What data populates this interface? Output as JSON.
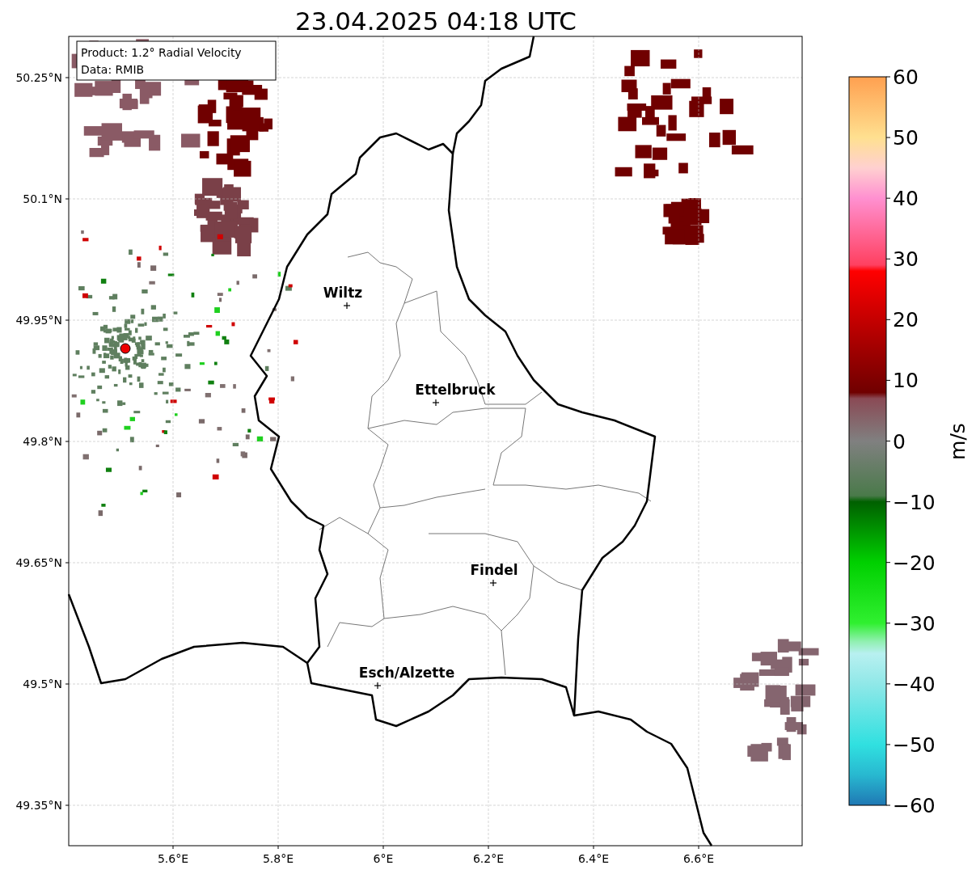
{
  "title": "23.04.2025 04:18 UTC",
  "info_box": {
    "lines": [
      "Product: 1.2° Radial Velocity",
      "Data: RMIB"
    ]
  },
  "map": {
    "lat_ticks": [
      "50.25°N",
      "50.1°N",
      "49.95°N",
      "49.8°N",
      "49.65°N",
      "49.5°N",
      "49.35°N"
    ],
    "lon_ticks": [
      "5.6°E",
      "5.8°E",
      "6°E",
      "6.2°E",
      "6.4°E",
      "6.6°E"
    ],
    "cities": [
      {
        "name": "Wiltz"
      },
      {
        "name": "Ettelbruck"
      },
      {
        "name": "Findel"
      },
      {
        "name": "Esch/Alzette"
      }
    ]
  },
  "colorbar": {
    "label": "m/s",
    "ticks": [
      "60",
      "50",
      "40",
      "30",
      "20",
      "10",
      "0",
      "−10",
      "−20",
      "−30",
      "−40",
      "−50",
      "−60"
    ]
  }
}
